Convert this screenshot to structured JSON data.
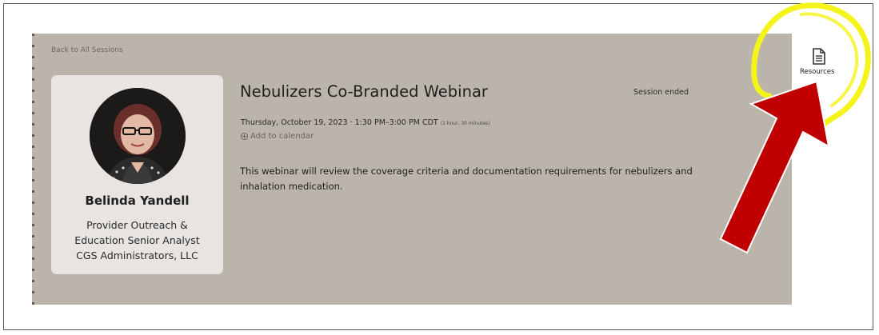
{
  "nav": {
    "back_label": "Back to All Sessions"
  },
  "speaker": {
    "name": "Belinda Yandell",
    "role": "Provider Outreach &\nEducation Senior Analyst\nCGS Administrators, LLC"
  },
  "session": {
    "title": "Nebulizers Co-Branded Webinar",
    "status": "Session ended",
    "datetime": "Thursday, October 19, 2023 · 1:30 PM–3:00 PM CDT",
    "duration": "(1 hour, 30 minutes)",
    "add_calendar_label": "Add to calendar",
    "description": "This webinar will review the coverage criteria and documentation requirements for nebulizers and inhalation medication."
  },
  "sidebar": {
    "resources_label": "Resources"
  },
  "colors": {
    "panel_bg": "#bbb4ab",
    "card_bg": "#e7e4e1",
    "highlight": "#f4f41a",
    "arrow_fill": "#c00000"
  },
  "icons": {
    "resources": "document-icon",
    "add_calendar": "plus-circle-icon"
  }
}
